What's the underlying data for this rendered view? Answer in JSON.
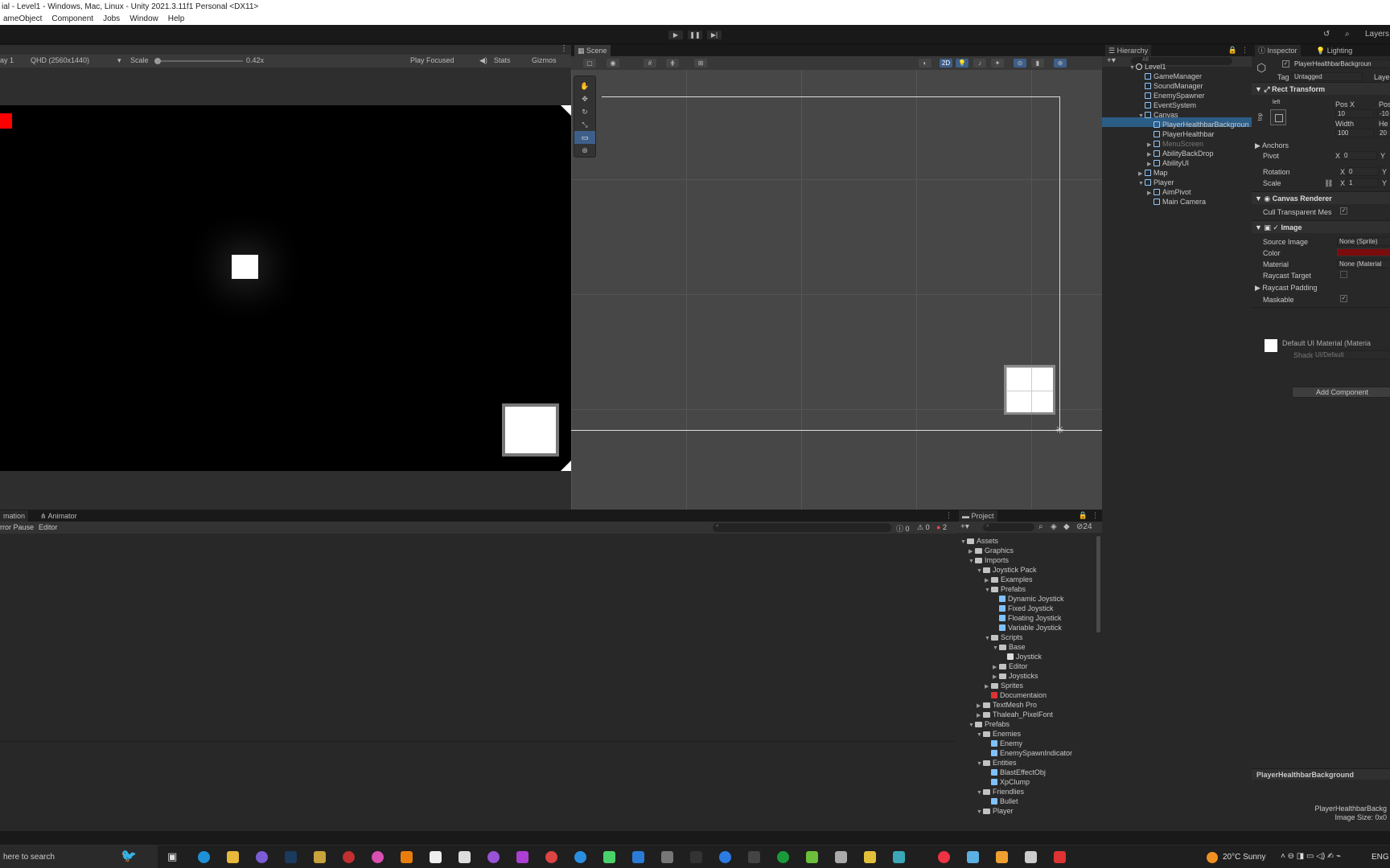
{
  "window": {
    "title": "ial - Level1 - Windows, Mac, Linux - Unity 2021.3.11f1 Personal <DX11>"
  },
  "menu": [
    "ameObject",
    "Component",
    "Jobs",
    "Window",
    "Help"
  ],
  "toolbar": {
    "play": "▶",
    "pause": "❚❚",
    "step": "▶|",
    "search": "⌕",
    "layers": "Layers"
  },
  "game": {
    "display": "ay 1",
    "resolution": "QHD (2560x1440)",
    "scale_label": "Scale",
    "scale_value": "0.42x",
    "play_focused": "Play Focused",
    "stats": "Stats",
    "gizmos": "Gizmos"
  },
  "scene": {
    "tab": "Scene",
    "mode_2d": "2D"
  },
  "hierarchy": {
    "tab": "Hierarchy",
    "search_placeholder": "All",
    "items": [
      {
        "label": "Level1",
        "arrow": "▼"
      },
      {
        "label": "GameManager",
        "arrow": ""
      },
      {
        "label": "SoundManager",
        "arrow": ""
      },
      {
        "label": "EnemySpawner",
        "arrow": ""
      },
      {
        "label": "EventSystem",
        "arrow": ""
      },
      {
        "label": "Canvas",
        "arrow": "▼"
      },
      {
        "label": "PlayerHealthbarBackgroun",
        "arrow": ""
      },
      {
        "label": "PlayerHealthbar",
        "arrow": ""
      },
      {
        "label": "MenuScreen",
        "arrow": "▶"
      },
      {
        "label": "AbilityBackDrop",
        "arrow": "▶"
      },
      {
        "label": "AbilityUI",
        "arrow": "▶"
      },
      {
        "label": "Map",
        "arrow": "▶"
      },
      {
        "label": "Player",
        "arrow": "▼"
      },
      {
        "label": "AimPivot",
        "arrow": "▶"
      },
      {
        "label": "Main Camera",
        "arrow": ""
      }
    ]
  },
  "inspector": {
    "tab": "Inspector",
    "tab2": "Lighting",
    "object_name": "PlayerHealthbarBackgroun",
    "tag_label": "Tag",
    "tag_value": "Untagged",
    "layer_label": "Laye",
    "rect_transform": "Rect Transform",
    "anchor_h": "left",
    "anchor_v": "top",
    "posx_label": "Pos X",
    "posy_label": "Pos",
    "posx": "10",
    "posy": "-10",
    "width_label": "Width",
    "height_label": "He",
    "width": "100",
    "height": "20",
    "anchors": "Anchors",
    "pivot": "Pivot",
    "pivot_x": "0",
    "rotation": "Rotation",
    "rotation_x": "0",
    "scale": "Scale",
    "scale_x": "1",
    "x": "X",
    "y": "Y",
    "canvas_renderer": "Canvas Renderer",
    "cull": "Cull Transparent Mes",
    "image": "Image",
    "source_image": "Source Image",
    "source_value": "None (Sprite)",
    "color": "Color",
    "color_value": "#7a0c0c",
    "material": "Material",
    "material_value": "None (Material",
    "raycast_target": "Raycast Target",
    "raycast_padding": "Raycast Padding",
    "maskable": "Maskable",
    "default_mat": "Default UI Material (Materia",
    "shader_label": "Shader",
    "shader_value": "UI/Default",
    "add_component": "Add Component",
    "preview_title": "PlayerHealthbarBackground",
    "preview_name": "PlayerHealthbarBackg",
    "preview_size": "Image Size: 0x0"
  },
  "console": {
    "tab1": "mation",
    "tab2": "Animator",
    "error_pause": "rror Pause",
    "editor": "Editor",
    "count_info": "0",
    "count_warn": "0",
    "count_err": "2"
  },
  "project": {
    "tab": "Project",
    "badge": "24",
    "items": [
      {
        "label": "Assets",
        "type": "folder",
        "depth": 0,
        "arrow": "▼"
      },
      {
        "label": "Graphics",
        "type": "folder",
        "depth": 1,
        "arrow": "▶"
      },
      {
        "label": "Imports",
        "type": "folder",
        "depth": 1,
        "arrow": "▼"
      },
      {
        "label": "Joystick Pack",
        "type": "folder",
        "depth": 2,
        "arrow": "▼"
      },
      {
        "label": "Examples",
        "type": "folder",
        "depth": 3,
        "arrow": "▶"
      },
      {
        "label": "Prefabs",
        "type": "folder",
        "depth": 3,
        "arrow": "▼"
      },
      {
        "label": "Dynamic Joystick",
        "type": "prefab",
        "depth": 4,
        "arrow": ""
      },
      {
        "label": "Fixed Joystick",
        "type": "prefab",
        "depth": 4,
        "arrow": ""
      },
      {
        "label": "Floating Joystick",
        "type": "prefab",
        "depth": 4,
        "arrow": ""
      },
      {
        "label": "Variable Joystick",
        "type": "prefab",
        "depth": 4,
        "arrow": ""
      },
      {
        "label": "Scripts",
        "type": "folder",
        "depth": 3,
        "arrow": "▼"
      },
      {
        "label": "Base",
        "type": "folder",
        "depth": 4,
        "arrow": "▼"
      },
      {
        "label": "Joystick",
        "type": "script",
        "depth": 5,
        "arrow": ""
      },
      {
        "label": "Editor",
        "type": "folder",
        "depth": 4,
        "arrow": "▶"
      },
      {
        "label": "Joysticks",
        "type": "folder",
        "depth": 4,
        "arrow": "▶"
      },
      {
        "label": "Sprites",
        "type": "folder",
        "depth": 3,
        "arrow": "▶"
      },
      {
        "label": "Documentaion",
        "type": "doc",
        "depth": 3,
        "arrow": ""
      },
      {
        "label": "TextMesh Pro",
        "type": "folder",
        "depth": 2,
        "arrow": "▶"
      },
      {
        "label": "Thaleah_PixelFont",
        "type": "folder",
        "depth": 2,
        "arrow": "▶"
      },
      {
        "label": "Prefabs",
        "type": "folder",
        "depth": 1,
        "arrow": "▼"
      },
      {
        "label": "Enemies",
        "type": "folder",
        "depth": 2,
        "arrow": "▼"
      },
      {
        "label": "Enemy",
        "type": "prefab",
        "depth": 3,
        "arrow": ""
      },
      {
        "label": "EnemySpawnIndicator",
        "type": "prefab",
        "depth": 3,
        "arrow": ""
      },
      {
        "label": "Entities",
        "type": "folder",
        "depth": 2,
        "arrow": "▼"
      },
      {
        "label": "BlastEffectObj",
        "type": "prefab",
        "depth": 3,
        "arrow": ""
      },
      {
        "label": "XpClump",
        "type": "prefab",
        "depth": 3,
        "arrow": ""
      },
      {
        "label": "Friendlies",
        "type": "folder",
        "depth": 2,
        "arrow": "▼"
      },
      {
        "label": "Bullet",
        "type": "prefab",
        "depth": 3,
        "arrow": ""
      },
      {
        "label": "Player",
        "type": "folder",
        "depth": 2,
        "arrow": "▼"
      }
    ]
  },
  "taskbar": {
    "search": "here to search",
    "weather": "20°C  Sunny",
    "lang": "ENG"
  }
}
